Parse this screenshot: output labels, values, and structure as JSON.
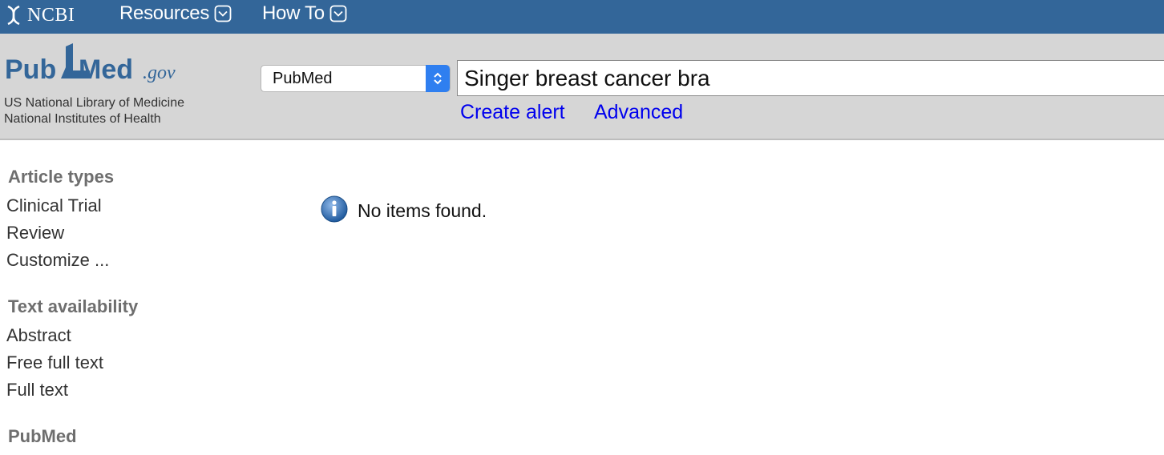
{
  "ncbi_bar": {
    "logo_text": "NCBI",
    "menus": [
      {
        "label": "Resources"
      },
      {
        "label": "How To"
      }
    ]
  },
  "header": {
    "logo": {
      "pub": "Pub",
      "med": "Med",
      "gov": ".gov"
    },
    "org_line1": "US National Library of Medicine",
    "org_line2": "National Institutes of Health",
    "database_select": {
      "selected": "PubMed"
    },
    "search": {
      "value": "Singer breast cancer bra"
    },
    "links": {
      "create_alert": "Create alert",
      "advanced": "Advanced"
    }
  },
  "sidebar": {
    "sections": [
      {
        "title": "Article types",
        "items": [
          "Clinical Trial",
          "Review",
          "Customize ..."
        ]
      },
      {
        "title": "Text availability",
        "items": [
          "Abstract",
          "Free full text",
          "Full text"
        ]
      },
      {
        "title": "PubMed",
        "items": []
      }
    ]
  },
  "results": {
    "message": "No items found."
  },
  "colors": {
    "ncbi_bar": "#336699",
    "header_bg": "#d6d6d6",
    "link": "#0000ee",
    "select_arrow": "#2f7ff0",
    "logo_blue": "#336699"
  },
  "icons": {
    "ncbi_logo": "dna-helix-icon",
    "menu_chevron": "chevron-down-icon",
    "select_arrows": "up-down-arrows-icon",
    "info": "info-icon"
  }
}
